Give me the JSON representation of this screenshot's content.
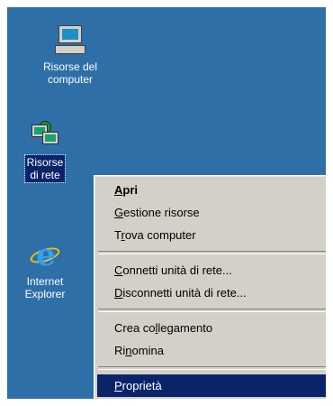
{
  "desktop": {
    "icons": [
      {
        "name": "my-computer",
        "label": "Risorse del\ncomputer",
        "selected": false
      },
      {
        "name": "network",
        "label": "Risorse\ndi rete",
        "selected": true
      },
      {
        "name": "internet-explorer",
        "label": "Internet\nExplorer",
        "selected": false
      }
    ],
    "background_color": "#2f6fa8"
  },
  "context_menu": {
    "items": [
      {
        "pre": "",
        "key": "A",
        "post": "pri",
        "default": true
      },
      {
        "pre": "",
        "key": "G",
        "post": "estione risorse"
      },
      {
        "pre": "T",
        "key": "r",
        "post": "ova computer"
      },
      {
        "separator": true
      },
      {
        "pre": "",
        "key": "C",
        "post": "onnetti unità di rete..."
      },
      {
        "pre": "",
        "key": "D",
        "post": "isconnetti unità di rete..."
      },
      {
        "separator": true
      },
      {
        "pre": "Crea co",
        "key": "l",
        "post": "legamento"
      },
      {
        "pre": "Ri",
        "key": "n",
        "post": "omina"
      },
      {
        "separator": true
      },
      {
        "pre": "",
        "key": "P",
        "post": "roprietà",
        "highlighted": true
      }
    ],
    "highlight_color": "#0a246a",
    "menu_color": "#d4d0c8"
  }
}
